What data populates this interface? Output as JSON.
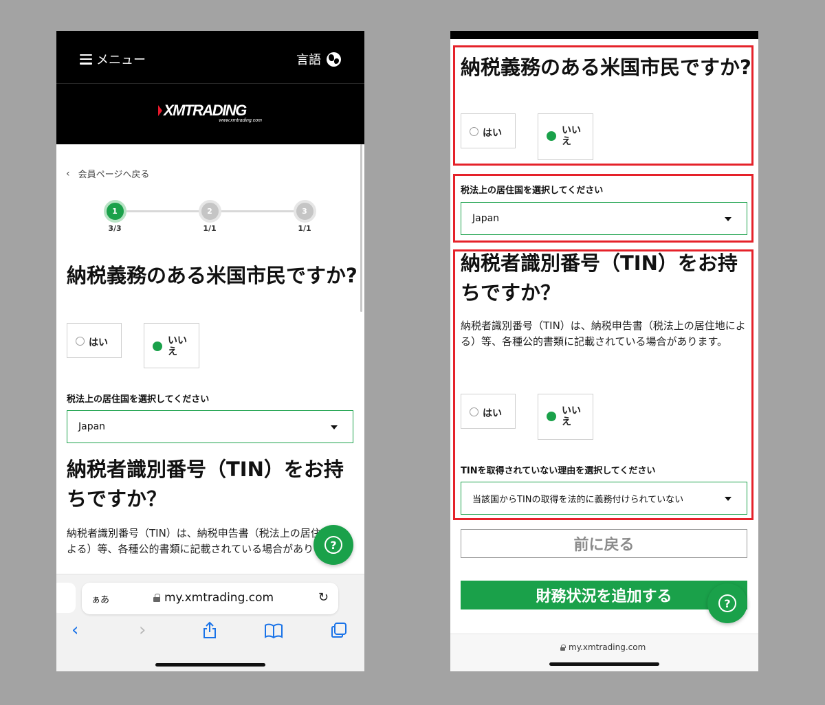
{
  "left_screen": {
    "header": {
      "menu_label": "メニュー",
      "language_label": "言語"
    },
    "logo": {
      "brand": "XMTRADING",
      "url": "www.xmtrading.com"
    },
    "back_link": "会員ページへ戻る",
    "stepper": [
      {
        "number": "1",
        "count": "3/3",
        "state": "active"
      },
      {
        "number": "2",
        "count": "1/1",
        "state": "inactive"
      },
      {
        "number": "3",
        "count": "1/1",
        "state": "inactive"
      }
    ],
    "us_citizen": {
      "question": "納税義務のある米国市民ですか?",
      "options": [
        {
          "label": "はい",
          "checked": false
        },
        {
          "label": "いいえ",
          "checked": true
        }
      ]
    },
    "tax_residence": {
      "label": "税法上の居住国を選択してください",
      "value": "Japan"
    },
    "tin": {
      "question": "納税者識別番号（TIN）をお持ちですか？",
      "description": "納税者識別番号（TIN）は、納税申告書（税法上の居住地による）等、各種公的書類に記載されている場合があります。"
    },
    "browser": {
      "text_size": "ぁあ",
      "url": "my.xmtrading.com"
    }
  },
  "right_screen": {
    "us_citizen": {
      "question": "納税義務のある米国市民ですか?",
      "options": [
        {
          "label": "はい",
          "checked": false
        },
        {
          "label": "いいえ",
          "checked": true
        }
      ]
    },
    "tax_residence": {
      "label": "税法上の居住国を選択してください",
      "value": "Japan"
    },
    "tin": {
      "question": "納税者識別番号（TIN）をお持ちですか？",
      "description": "納税者識別番号（TIN）は、納税申告書（税法上の居住地による）等、各種公的書類に記載されている場合があります。",
      "options": [
        {
          "label": "はい",
          "checked": false
        },
        {
          "label": "いいえ",
          "checked": true
        }
      ],
      "reason_label": "TINを取得されていない理由を選択してください",
      "reason_value": "当該国からTINの取得を法的に義務付けられていない"
    },
    "buttons": {
      "back": "前に戻る",
      "next": "財務状況を追加する"
    },
    "browser": {
      "url": "my.xmtrading.com"
    }
  },
  "colors": {
    "accent_green": "#1aa14a",
    "highlight_red": "#e5222a",
    "safari_blue": "#1a73e8"
  },
  "icons": [
    "hamburger-icon",
    "globe-icon",
    "chevron-left-icon",
    "help-icon",
    "lock-icon",
    "reload-icon",
    "share-icon",
    "bookmarks-icon",
    "tabs-icon"
  ]
}
